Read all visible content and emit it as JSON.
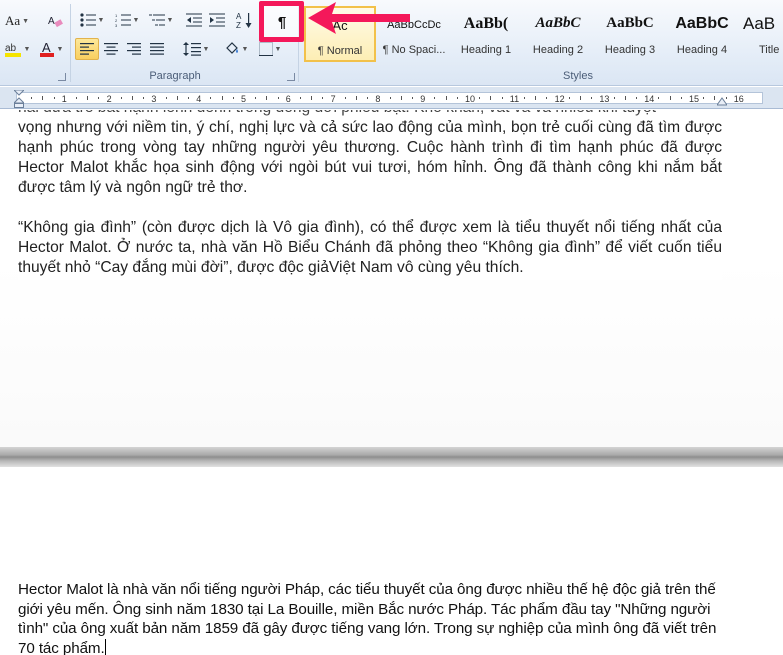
{
  "ribbon": {
    "font_group": {
      "change_case_label": "Aa",
      "highlight_color": "#f5e400",
      "font_color": "#e02020"
    },
    "paragraph_group": {
      "label": "Paragraph",
      "sort_label": "A\nZ",
      "show_hide_label": "¶"
    },
    "styles_group": {
      "label": "Styles",
      "items": [
        {
          "sample": "Ac",
          "name": "¶ Normal"
        },
        {
          "sample": "AaBbCcDc",
          "name": "¶ No Spaci..."
        },
        {
          "sample": "AaBb(",
          "name": "Heading 1"
        },
        {
          "sample": "AaBbC",
          "name": "Heading 2"
        },
        {
          "sample": "AaBbC",
          "name": "Heading 3"
        },
        {
          "sample": "AaBbC",
          "name": "Heading 4"
        },
        {
          "sample": "AaB",
          "name": "Title"
        }
      ]
    }
  },
  "ruler": {
    "labels": [
      "1",
      "2",
      "3",
      "4",
      "5",
      "6",
      "7",
      "8",
      "9",
      "10",
      "11",
      "12",
      "13",
      "14",
      "15",
      "16"
    ]
  },
  "document": {
    "page1": {
      "partial_line": "hai đứa trẻ bất hạnh lênh đênh trong dòng đời phiêu bạt. Khó khăn, vất vả và nhiều khi tuyệt",
      "para1": "vọng nhưng với niềm tin, ý chí, nghị lực  và cả sức lao động của mình, bọn trẻ cuối cùng đã tìm được hạnh phúc trong vòng tay những người yêu thương. Cuộc hành trình đi tìm hạnh phúc đã được Hector Malot khắc họa sinh động với ngòi bút vui tươi, hóm hỉnh. Ông đã thành công khi nắm bắt được tâm lý và ngôn ngữ trẻ thơ.",
      "para2": "“Không gia đình” (còn được dịch là Vô gia đình), có thể được xem là tiểu thuyết nổi tiếng nhất của Hector Malot. Ở nước ta, nhà văn Hồ Biểu Chánh đã phỏng theo “Không gia đình” để viết cuốn tiểu thuyết nhỏ “Cay đắng mùi đời”, được độc giảViệt Nam vô cùng yêu thích."
    },
    "page2": {
      "para1": "Hector Malot là nhà văn nổi tiếng người Pháp, các tiểu thuyết của ông được nhiều thế hệ độc giả trên thế giới yêu mến. Ông sinh năm 1830 tại La Bouille, miền Bắc nước Pháp. Tác phẩm đầu tay \"Những người tình\" của ông xuất bản năm 1859 đã gây được tiếng vang lớn. Trong sự nghiệp của mình ông đã viết trên 70 tác phẩm."
    }
  },
  "annotation": {
    "highlight_color": "#f4185a",
    "arrow_color": "#f4185a"
  }
}
